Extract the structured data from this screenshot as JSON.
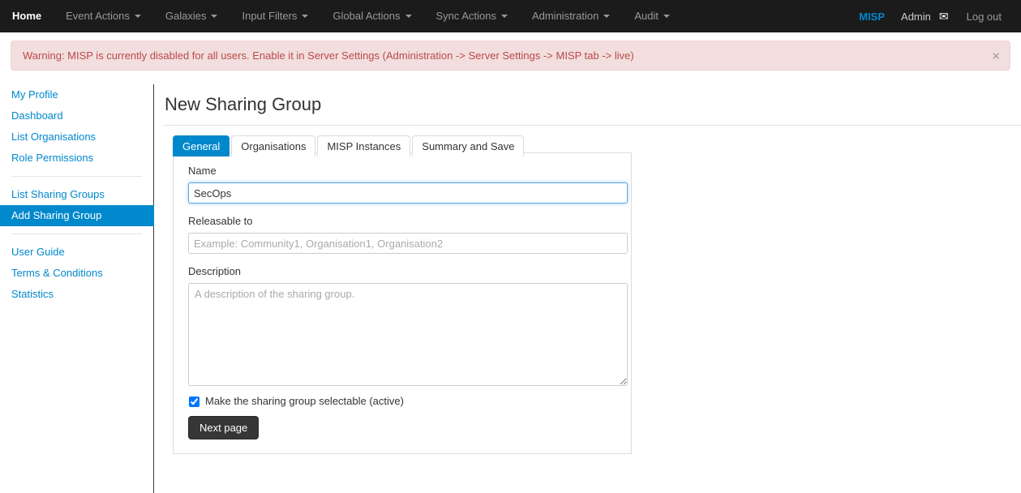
{
  "navbar": {
    "left_items": [
      {
        "label": "Home",
        "has_caret": false,
        "active": true
      },
      {
        "label": "Event Actions",
        "has_caret": true,
        "active": false
      },
      {
        "label": "Galaxies",
        "has_caret": true,
        "active": false
      },
      {
        "label": "Input Filters",
        "has_caret": true,
        "active": false
      },
      {
        "label": "Global Actions",
        "has_caret": true,
        "active": false
      },
      {
        "label": "Sync Actions",
        "has_caret": true,
        "active": false
      },
      {
        "label": "Administration",
        "has_caret": true,
        "active": false
      },
      {
        "label": "Audit",
        "has_caret": true,
        "active": false
      }
    ],
    "brand": "MISP",
    "user": "Admin",
    "envelope_icon": "envelope-icon",
    "envelope_glyph": "✉",
    "logout": "Log out",
    "bg_color": "#1b1b1b",
    "brand_color": "#0088cc"
  },
  "alert": {
    "text": "Warning: MISP is currently disabled for all users. Enable it in Server Settings (Administration -> Server Settings -> MISP tab -> live)",
    "close_glyph": "×",
    "bg_color": "#f2dede",
    "border_color": "#eed3d7",
    "text_color": "#b94a48"
  },
  "sidebar": {
    "accent_color": "#0088cc",
    "groups": [
      {
        "items": [
          {
            "label": "My Profile",
            "active": false
          },
          {
            "label": "Dashboard",
            "active": false
          },
          {
            "label": "List Organisations",
            "active": false
          },
          {
            "label": "Role Permissions",
            "active": false
          }
        ]
      },
      {
        "items": [
          {
            "label": "List Sharing Groups",
            "active": false
          },
          {
            "label": "Add Sharing Group",
            "active": true
          }
        ]
      },
      {
        "items": [
          {
            "label": "User Guide",
            "active": false
          },
          {
            "label": "Terms & Conditions",
            "active": false
          },
          {
            "label": "Statistics",
            "active": false
          }
        ]
      }
    ]
  },
  "main": {
    "title": "New Sharing Group",
    "tabs": [
      {
        "label": "General",
        "active": true
      },
      {
        "label": "Organisations",
        "active": false
      },
      {
        "label": "MISP Instances",
        "active": false
      },
      {
        "label": "Summary and Save",
        "active": false
      }
    ],
    "form": {
      "name_label": "Name",
      "name_value": "SecOps",
      "name_placeholder": "",
      "releasable_label": "Releasable to",
      "releasable_value": "",
      "releasable_placeholder": "Example: Community1, Organisation1, Organisation2",
      "description_label": "Description",
      "description_value": "",
      "description_placeholder": "A description of the sharing group.",
      "checkbox_label": "Make the sharing group selectable (active)",
      "checkbox_checked": true,
      "next_button": "Next page"
    }
  }
}
